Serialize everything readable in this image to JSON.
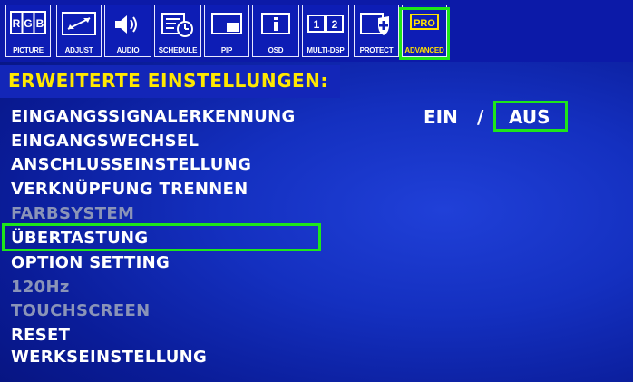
{
  "tabs": [
    {
      "id": "picture",
      "label": "PICTURE",
      "icon": "rgb-icon"
    },
    {
      "id": "adjust",
      "label": "ADJUST",
      "icon": "adjust-icon"
    },
    {
      "id": "audio",
      "label": "AUDIO",
      "icon": "speaker-icon"
    },
    {
      "id": "schedule",
      "label": "SCHEDULE",
      "icon": "schedule-icon"
    },
    {
      "id": "pip",
      "label": "PIP",
      "icon": "pip-icon"
    },
    {
      "id": "osd",
      "label": "OSD",
      "icon": "info-icon"
    },
    {
      "id": "multidsp",
      "label": "MULTI-DSP",
      "icon": "multi-display-icon"
    },
    {
      "id": "protect",
      "label": "PROTECT",
      "icon": "shield-icon"
    },
    {
      "id": "advanced",
      "label": "ADVANCED",
      "icon": "pro-icon",
      "icon_text": "PRO"
    }
  ],
  "rgb_icon_text": {
    "r": "R",
    "g": "G",
    "b": "B"
  },
  "multi_icon_text": {
    "a": "1",
    "b": "2"
  },
  "heading": "ERWEITERTE EINSTELLUNGEN:",
  "menu": [
    {
      "label": "EINGANGSSIGNALERKENNUNG",
      "enabled": true
    },
    {
      "label": "EINGANGSWECHSEL",
      "enabled": true
    },
    {
      "label": "ANSCHLUSSEINSTELLUNG",
      "enabled": true
    },
    {
      "label": "VERKNÜPFUNG TRENNEN",
      "enabled": true
    },
    {
      "label": "FARBSYSTEM",
      "enabled": false
    },
    {
      "label": "ÜBERTASTUNG",
      "enabled": true,
      "selected": true
    },
    {
      "label": "OPTION SETTING",
      "enabled": true
    },
    {
      "label": "120Hz",
      "enabled": false
    },
    {
      "label": "TOUCHSCREEN",
      "enabled": false
    },
    {
      "label": "RESET",
      "enabled": true
    },
    {
      "label": "WERKSEINSTELLUNG",
      "enabled": true
    }
  ],
  "value": {
    "on": "EIN",
    "separator": "/",
    "off": "AUS",
    "selected": "AUS"
  },
  "colors": {
    "background": "#0d1f9e",
    "heading": "#ffe800",
    "text": "#ffffff",
    "disabled": "#8a94b8",
    "highlight": "#1ee61a",
    "advanced_label": "#ffe100"
  }
}
